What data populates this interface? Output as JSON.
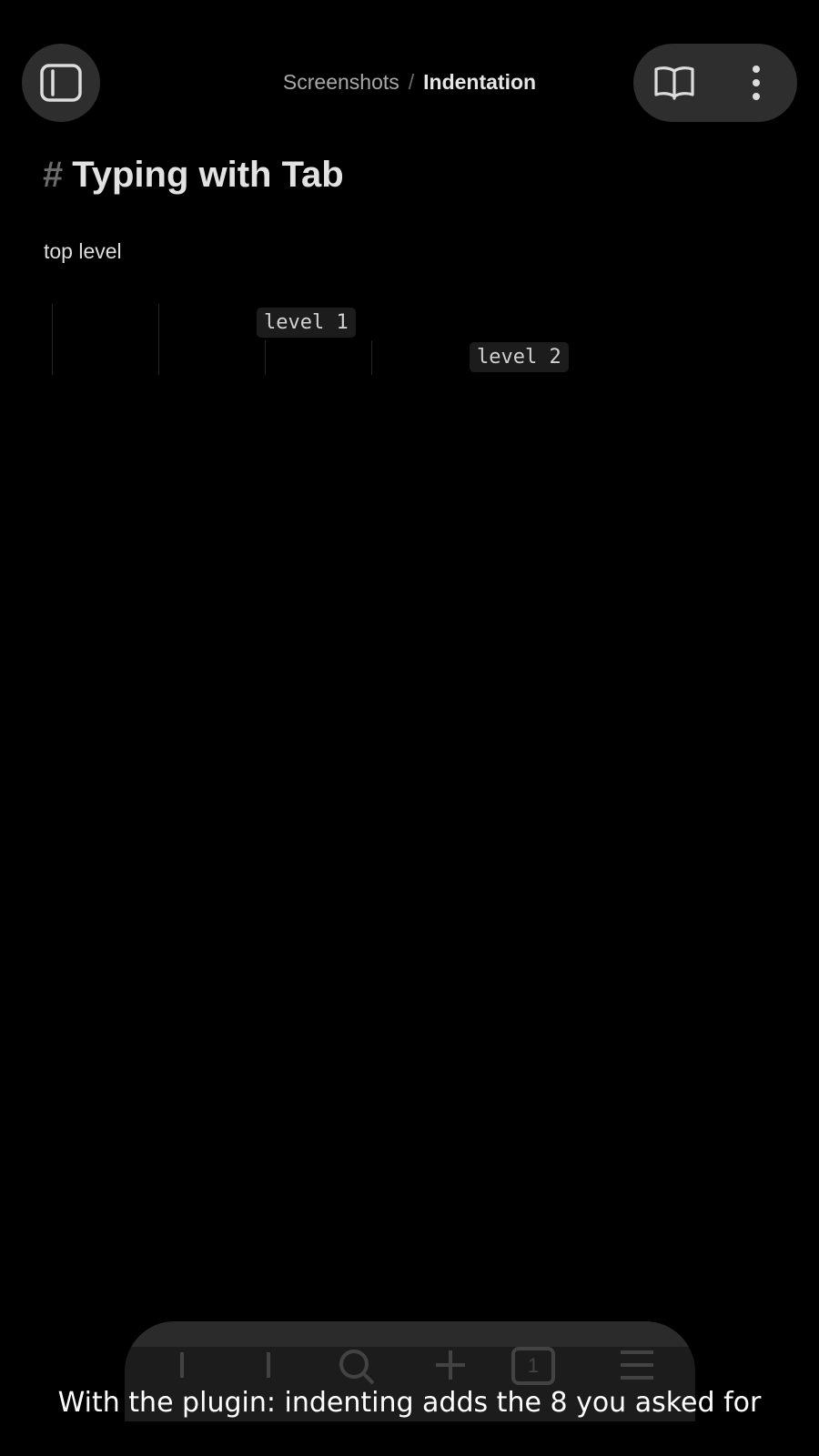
{
  "header": {
    "sidebar_toggle_icon": "sidebar-toggle-icon",
    "breadcrumb": {
      "parent": "Screenshots",
      "separator": "/",
      "current": "Indentation"
    },
    "reading_mode_icon": "book-open-icon",
    "more_options_icon": "more-vertical-icon"
  },
  "note": {
    "heading_marker": "#",
    "heading": "Typing with Tab",
    "paragraph": "top level",
    "code_lines": [
      {
        "text": "level 1",
        "indent_level": 1
      },
      {
        "text": "level 2",
        "indent_level": 2
      }
    ]
  },
  "bottom_toolbar": {
    "icons": [
      "back-icon",
      "forward-icon",
      "search-icon",
      "plus-icon",
      "tab-count-icon",
      "menu-icon"
    ],
    "tab_count": "1"
  },
  "caption": "With the plugin: indenting adds the 8 you asked for",
  "colors": {
    "background": "#000000",
    "button_background": "#2e2e2e",
    "text": "#dadada",
    "code_background": "#1c1c1c",
    "caption": "#ffffff"
  }
}
